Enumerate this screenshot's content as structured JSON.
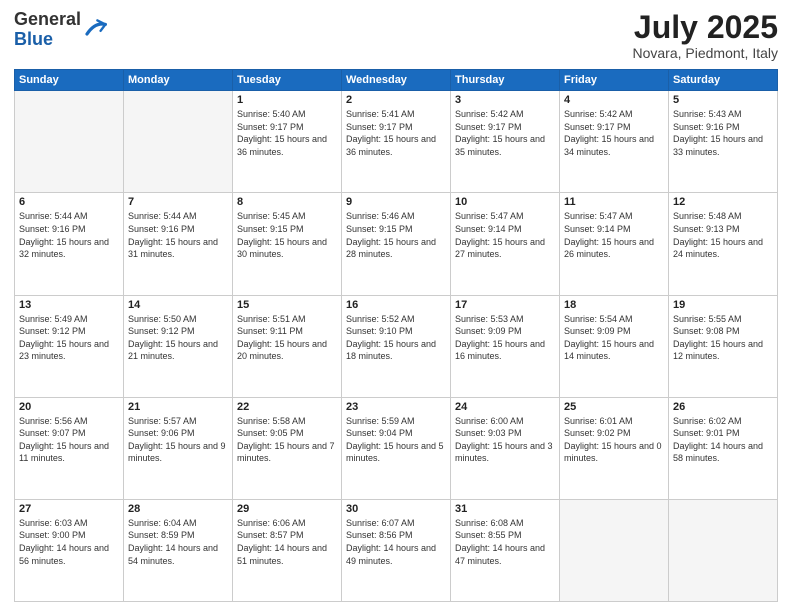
{
  "header": {
    "logo_general": "General",
    "logo_blue": "Blue",
    "month_title": "July 2025",
    "location": "Novara, Piedmont, Italy"
  },
  "calendar": {
    "weekdays": [
      "Sunday",
      "Monday",
      "Tuesday",
      "Wednesday",
      "Thursday",
      "Friday",
      "Saturday"
    ],
    "weeks": [
      [
        {
          "day": "",
          "empty": true
        },
        {
          "day": "",
          "empty": true
        },
        {
          "day": "1",
          "sunrise": "5:40 AM",
          "sunset": "9:17 PM",
          "daylight": "15 hours and 36 minutes."
        },
        {
          "day": "2",
          "sunrise": "5:41 AM",
          "sunset": "9:17 PM",
          "daylight": "15 hours and 36 minutes."
        },
        {
          "day": "3",
          "sunrise": "5:42 AM",
          "sunset": "9:17 PM",
          "daylight": "15 hours and 35 minutes."
        },
        {
          "day": "4",
          "sunrise": "5:42 AM",
          "sunset": "9:17 PM",
          "daylight": "15 hours and 34 minutes."
        },
        {
          "day": "5",
          "sunrise": "5:43 AM",
          "sunset": "9:16 PM",
          "daylight": "15 hours and 33 minutes."
        }
      ],
      [
        {
          "day": "6",
          "sunrise": "5:44 AM",
          "sunset": "9:16 PM",
          "daylight": "15 hours and 32 minutes."
        },
        {
          "day": "7",
          "sunrise": "5:44 AM",
          "sunset": "9:16 PM",
          "daylight": "15 hours and 31 minutes."
        },
        {
          "day": "8",
          "sunrise": "5:45 AM",
          "sunset": "9:15 PM",
          "daylight": "15 hours and 30 minutes."
        },
        {
          "day": "9",
          "sunrise": "5:46 AM",
          "sunset": "9:15 PM",
          "daylight": "15 hours and 28 minutes."
        },
        {
          "day": "10",
          "sunrise": "5:47 AM",
          "sunset": "9:14 PM",
          "daylight": "15 hours and 27 minutes."
        },
        {
          "day": "11",
          "sunrise": "5:47 AM",
          "sunset": "9:14 PM",
          "daylight": "15 hours and 26 minutes."
        },
        {
          "day": "12",
          "sunrise": "5:48 AM",
          "sunset": "9:13 PM",
          "daylight": "15 hours and 24 minutes."
        }
      ],
      [
        {
          "day": "13",
          "sunrise": "5:49 AM",
          "sunset": "9:12 PM",
          "daylight": "15 hours and 23 minutes."
        },
        {
          "day": "14",
          "sunrise": "5:50 AM",
          "sunset": "9:12 PM",
          "daylight": "15 hours and 21 minutes."
        },
        {
          "day": "15",
          "sunrise": "5:51 AM",
          "sunset": "9:11 PM",
          "daylight": "15 hours and 20 minutes."
        },
        {
          "day": "16",
          "sunrise": "5:52 AM",
          "sunset": "9:10 PM",
          "daylight": "15 hours and 18 minutes."
        },
        {
          "day": "17",
          "sunrise": "5:53 AM",
          "sunset": "9:09 PM",
          "daylight": "15 hours and 16 minutes."
        },
        {
          "day": "18",
          "sunrise": "5:54 AM",
          "sunset": "9:09 PM",
          "daylight": "15 hours and 14 minutes."
        },
        {
          "day": "19",
          "sunrise": "5:55 AM",
          "sunset": "9:08 PM",
          "daylight": "15 hours and 12 minutes."
        }
      ],
      [
        {
          "day": "20",
          "sunrise": "5:56 AM",
          "sunset": "9:07 PM",
          "daylight": "15 hours and 11 minutes."
        },
        {
          "day": "21",
          "sunrise": "5:57 AM",
          "sunset": "9:06 PM",
          "daylight": "15 hours and 9 minutes."
        },
        {
          "day": "22",
          "sunrise": "5:58 AM",
          "sunset": "9:05 PM",
          "daylight": "15 hours and 7 minutes."
        },
        {
          "day": "23",
          "sunrise": "5:59 AM",
          "sunset": "9:04 PM",
          "daylight": "15 hours and 5 minutes."
        },
        {
          "day": "24",
          "sunrise": "6:00 AM",
          "sunset": "9:03 PM",
          "daylight": "15 hours and 3 minutes."
        },
        {
          "day": "25",
          "sunrise": "6:01 AM",
          "sunset": "9:02 PM",
          "daylight": "15 hours and 0 minutes."
        },
        {
          "day": "26",
          "sunrise": "6:02 AM",
          "sunset": "9:01 PM",
          "daylight": "14 hours and 58 minutes."
        }
      ],
      [
        {
          "day": "27",
          "sunrise": "6:03 AM",
          "sunset": "9:00 PM",
          "daylight": "14 hours and 56 minutes."
        },
        {
          "day": "28",
          "sunrise": "6:04 AM",
          "sunset": "8:59 PM",
          "daylight": "14 hours and 54 minutes."
        },
        {
          "day": "29",
          "sunrise": "6:06 AM",
          "sunset": "8:57 PM",
          "daylight": "14 hours and 51 minutes."
        },
        {
          "day": "30",
          "sunrise": "6:07 AM",
          "sunset": "8:56 PM",
          "daylight": "14 hours and 49 minutes."
        },
        {
          "day": "31",
          "sunrise": "6:08 AM",
          "sunset": "8:55 PM",
          "daylight": "14 hours and 47 minutes."
        },
        {
          "day": "",
          "empty": true
        },
        {
          "day": "",
          "empty": true
        }
      ]
    ]
  }
}
